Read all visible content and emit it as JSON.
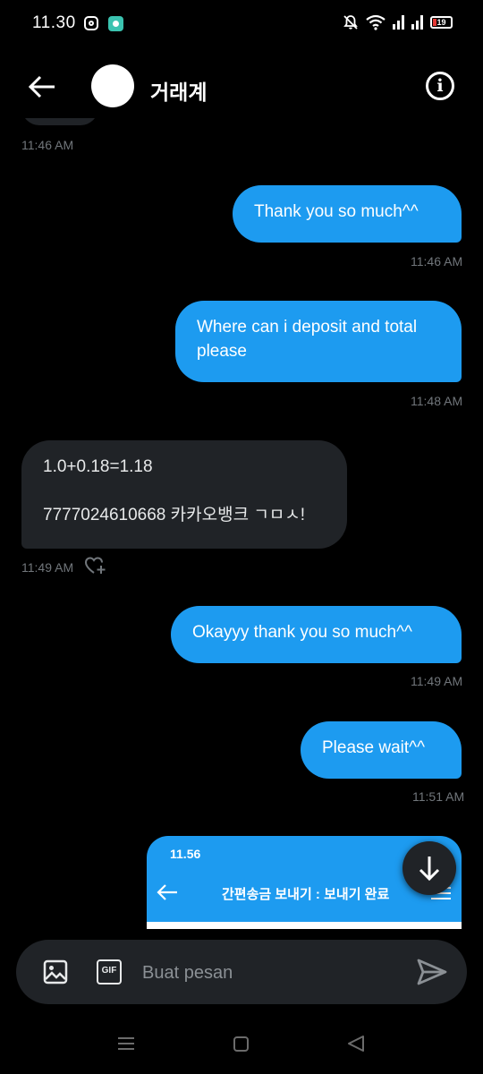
{
  "status_bar": {
    "time": "11.30",
    "battery": "19"
  },
  "header": {
    "title": "거래계"
  },
  "messages": [
    {
      "direction": "in",
      "text": "",
      "time": "11:46 AM"
    },
    {
      "direction": "out",
      "text": "Thank you so much^^",
      "time": "11:46 AM"
    },
    {
      "direction": "out",
      "text": "Where can i deposit and total please",
      "time": "11:48 AM"
    },
    {
      "direction": "in",
      "line1": "1.0+0.18=1.18",
      "line2": "7777024610668 카카오뱅크 ㄱㅁㅅ!",
      "time": "11:49 AM"
    },
    {
      "direction": "out",
      "text": "Okayyy thank you so much^^",
      "time": "11:49 AM"
    },
    {
      "direction": "out",
      "text": "Please wait^^",
      "time": "11:51 AM"
    }
  ],
  "image_preview": {
    "time": "11.56",
    "title": "간편송금 보내기 : 보내기 완료"
  },
  "composer": {
    "placeholder": "Buat pesan",
    "gif_label": "GIF"
  },
  "icons": {
    "back": "arrow-left-icon",
    "info": "info-icon",
    "image": "image-icon",
    "gif": "gif-icon",
    "send": "send-icon",
    "scroll_down": "arrow-down-icon",
    "react": "heart-plus-icon"
  },
  "colors": {
    "background": "#000000",
    "outgoing_bubble": "#1d9bf0",
    "incoming_bubble": "#202327",
    "timestamp": "#71767b"
  }
}
